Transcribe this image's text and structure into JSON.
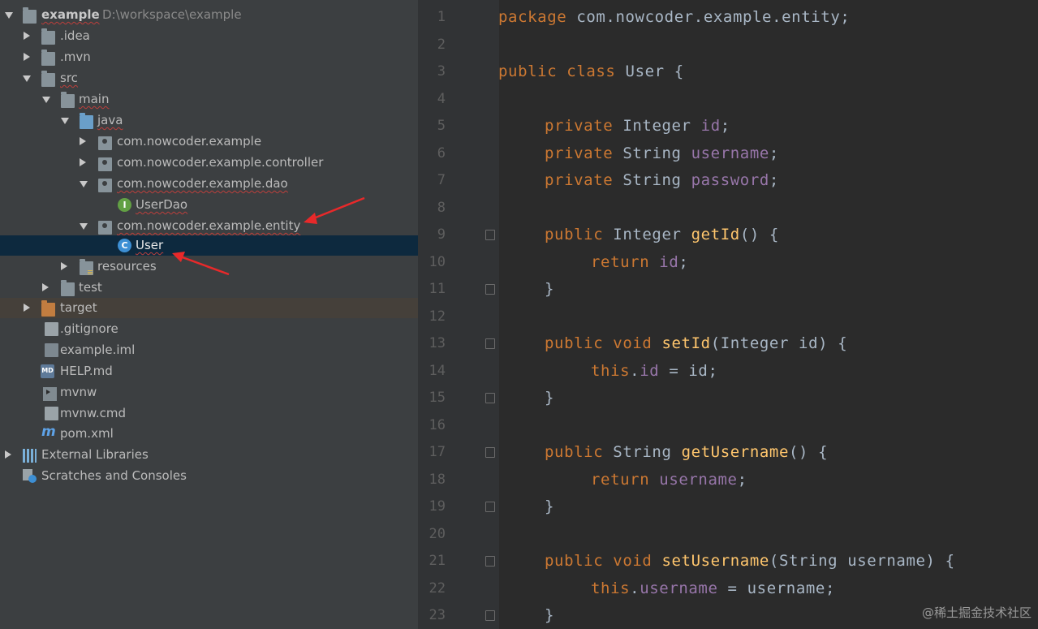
{
  "project_tree": {
    "root": {
      "label": "example",
      "path": "D:\\workspace\\example"
    },
    "items": [
      {
        "label": ".idea"
      },
      {
        "label": ".mvn"
      },
      {
        "label": "src"
      },
      {
        "label": "main"
      },
      {
        "label": "java"
      },
      {
        "label": "com.nowcoder.example"
      },
      {
        "label": "com.nowcoder.example.controller"
      },
      {
        "label": "com.nowcoder.example.dao"
      },
      {
        "label": "UserDao",
        "icon_letter": "I"
      },
      {
        "label": "com.nowcoder.example.entity"
      },
      {
        "label": "User",
        "icon_letter": "C"
      },
      {
        "label": "resources"
      },
      {
        "label": "test"
      },
      {
        "label": "target"
      },
      {
        "label": ".gitignore"
      },
      {
        "label": "example.iml"
      },
      {
        "label": "HELP.md",
        "icon_letter": "MD"
      },
      {
        "label": "mvnw"
      },
      {
        "label": "mvnw.cmd"
      },
      {
        "label": "pom.xml",
        "icon_letter": "m"
      },
      {
        "label": "External Libraries"
      },
      {
        "label": "Scratches and Consoles"
      }
    ]
  },
  "editor": {
    "line_numbers": [
      "1",
      "2",
      "3",
      "4",
      "5",
      "6",
      "7",
      "8",
      "9",
      "10",
      "11",
      "12",
      "13",
      "14",
      "15",
      "16",
      "17",
      "18",
      "19",
      "20",
      "21",
      "22",
      "23"
    ],
    "lines": [
      [
        "package",
        " com.nowcoder.example.entity;"
      ],
      [],
      [
        "public",
        " ",
        "class",
        " ",
        "User",
        " {"
      ],
      [],
      [
        "private",
        " ",
        "Integer",
        " ",
        "id",
        ";"
      ],
      [
        "private",
        " ",
        "String",
        " ",
        "username",
        ";"
      ],
      [
        "private",
        " ",
        "String",
        " ",
        "password",
        ";"
      ],
      [],
      [
        "public",
        " ",
        "Integer",
        " ",
        "getId",
        "() {"
      ],
      [
        "return",
        " ",
        "id",
        ";"
      ],
      [
        "}"
      ],
      [],
      [
        "public",
        " ",
        "void",
        " ",
        "setId",
        "(Integer id) {"
      ],
      [
        "this",
        ".",
        "id",
        " = id;"
      ],
      [
        "}"
      ],
      [],
      [
        "public",
        " ",
        "String",
        " ",
        "getUsername",
        "() {"
      ],
      [
        "return",
        " ",
        "username",
        ";"
      ],
      [
        "}"
      ],
      [],
      [
        "public",
        " ",
        "void",
        " ",
        "setUsername",
        "(String username) {"
      ],
      [
        "this",
        ".",
        "username",
        " = username;"
      ],
      [
        "}"
      ]
    ]
  },
  "watermark": "@稀土掘金技术社区",
  "colors": {
    "keyword": "#cc7832",
    "field": "#9876aa",
    "method": "#ffc66d",
    "text": "#a9b7c6",
    "selection": "#0d293e",
    "annotation_arrow": "#e8292a"
  }
}
